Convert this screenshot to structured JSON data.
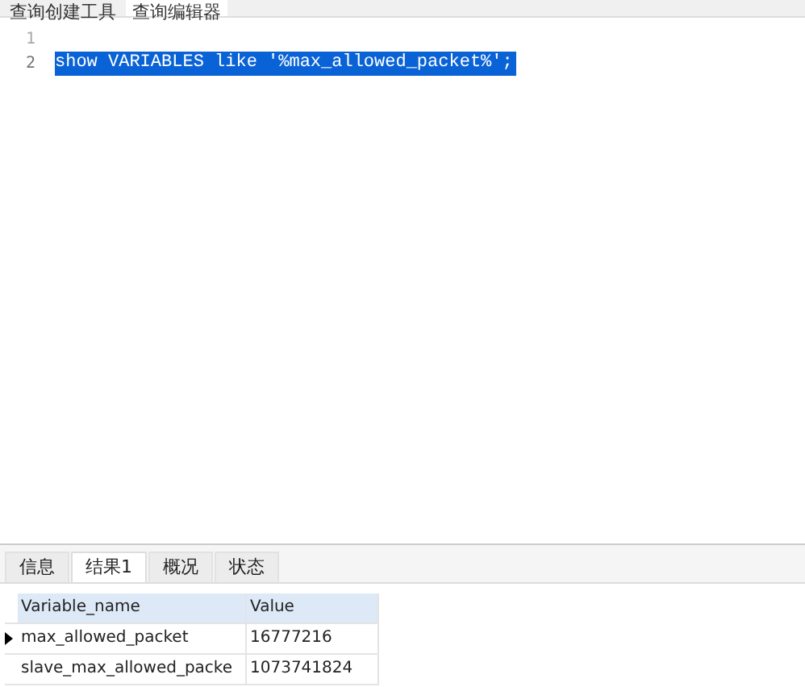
{
  "top_tabs": [
    {
      "label": "查询创建工具",
      "selected": false
    },
    {
      "label": "查询编辑器",
      "selected": true
    }
  ],
  "editor": {
    "lines": [
      {
        "number": "1",
        "selected": false
      },
      {
        "number": "2",
        "code": "show VARIABLES like '%max_allowed_packet%';",
        "selected": true
      }
    ]
  },
  "result_tabs": [
    {
      "label": "信息",
      "selected": false
    },
    {
      "label": "结果1",
      "selected": true
    },
    {
      "label": "概况",
      "selected": false
    },
    {
      "label": "状态",
      "selected": false
    }
  ],
  "table": {
    "columns": [
      "Variable_name",
      "Value"
    ],
    "rows": [
      {
        "cells": [
          "max_allowed_packet",
          "16777216"
        ],
        "current": true
      },
      {
        "cells": [
          "slave_max_allowed_packe",
          "1073741824"
        ],
        "current": false
      }
    ]
  }
}
